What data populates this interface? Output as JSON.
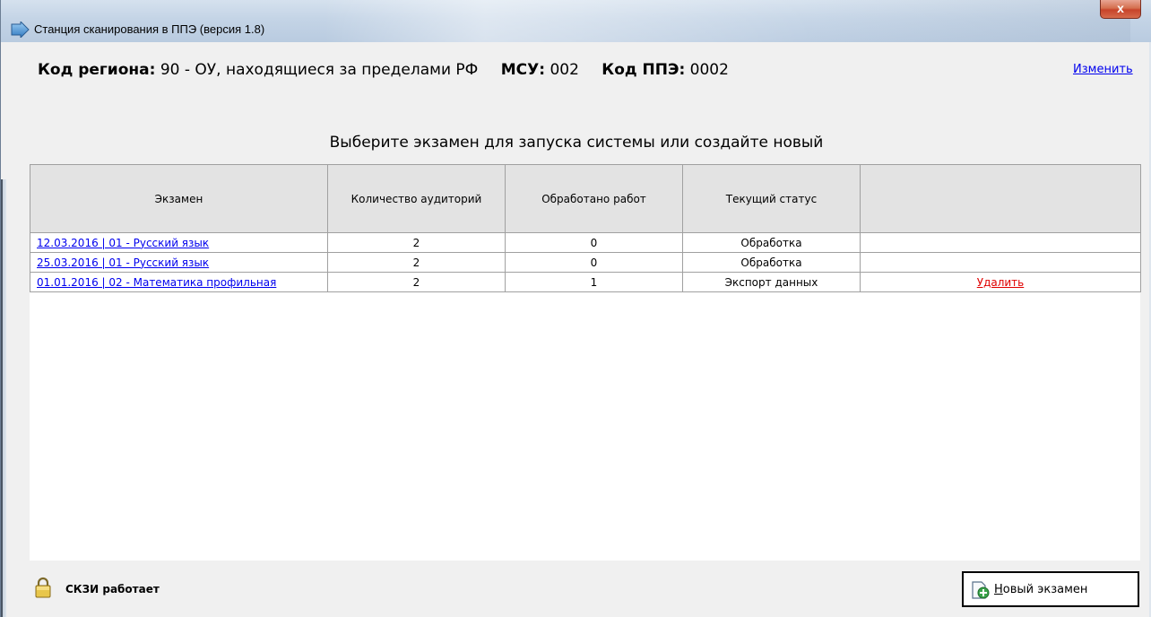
{
  "window": {
    "title": "Станция сканирования в ППЭ (версия 1.8)",
    "close_label": "x"
  },
  "header": {
    "region_label": "Код региона:",
    "region_value": "90 - ОУ, находящиеся за пределами РФ",
    "msu_label": "МСУ:",
    "msu_value": "002",
    "ppe_label": "Код ППЭ:",
    "ppe_value": "0002",
    "change_link": "Изменить"
  },
  "prompt": "Выберите экзамен для запуска системы или создайте новый",
  "table": {
    "columns": [
      "Экзамен",
      "Количество аудиторий",
      "Обработано работ",
      "Текущий статус",
      ""
    ],
    "rows": [
      {
        "exam": "12.03.2016 | 01 - Русский язык",
        "rooms": "2",
        "processed": "0",
        "status": "Обработка",
        "action": ""
      },
      {
        "exam": "25.03.2016 | 01 - Русский язык",
        "rooms": "2",
        "processed": "0",
        "status": "Обработка",
        "action": ""
      },
      {
        "exam": "01.01.2016 | 02 - Математика профильная",
        "rooms": "2",
        "processed": "1",
        "status": "Экспорт данных",
        "action": "Удалить"
      }
    ]
  },
  "footer": {
    "status_text": "СКЗИ работает",
    "lock_icon": "lock-icon",
    "new_exam_hotkey": "Н",
    "new_exam_rest": "овый экзамен"
  },
  "colors": {
    "link": "#0000ee",
    "delete_link": "#e00000",
    "header_bg": "#e3e3e3"
  }
}
